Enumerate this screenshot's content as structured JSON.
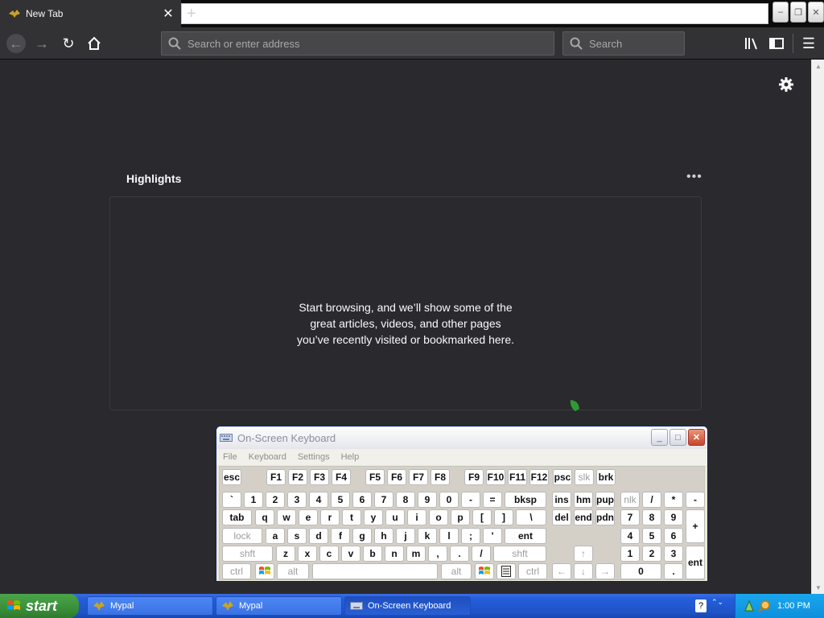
{
  "browser": {
    "tab_title": "New Tab",
    "tab_close": "✕",
    "newtab_plus": "+",
    "url_placeholder": "Search or enter address",
    "search_placeholder": "Search"
  },
  "page": {
    "highlights_title": "Highlights",
    "highlights_more": "•••",
    "highlights_message": "Start browsing, and we’ll show some of the great articles, videos, and other pages you’ve recently visited or bookmarked here."
  },
  "osk": {
    "title": "On-Screen Keyboard",
    "menu": [
      "File",
      "Keyboard",
      "Settings",
      "Help"
    ],
    "keys": [
      {
        "label": "esc"
      },
      {
        "label": "F1"
      },
      {
        "label": "F2"
      },
      {
        "label": "F3"
      },
      {
        "label": "F4"
      },
      {
        "label": "F5"
      },
      {
        "label": "F6"
      },
      {
        "label": "F7"
      },
      {
        "label": "F8"
      },
      {
        "label": "F9"
      },
      {
        "label": "F10"
      },
      {
        "label": "F11"
      },
      {
        "label": "F12"
      },
      {
        "label": "psc"
      },
      {
        "label": "slk",
        "dim": true
      },
      {
        "label": "brk"
      },
      {
        "label": "`"
      },
      {
        "label": "1"
      },
      {
        "label": "2"
      },
      {
        "label": "3"
      },
      {
        "label": "4"
      },
      {
        "label": "5"
      },
      {
        "label": "6"
      },
      {
        "label": "7"
      },
      {
        "label": "8"
      },
      {
        "label": "9"
      },
      {
        "label": "0"
      },
      {
        "label": "-"
      },
      {
        "label": "="
      },
      {
        "label": "bksp"
      },
      {
        "label": "ins"
      },
      {
        "label": "hm"
      },
      {
        "label": "pup"
      },
      {
        "label": "nlk",
        "dim": true
      },
      {
        "label": "/"
      },
      {
        "label": "*"
      },
      {
        "label": "-"
      },
      {
        "label": "tab"
      },
      {
        "label": "q"
      },
      {
        "label": "w"
      },
      {
        "label": "e"
      },
      {
        "label": "r"
      },
      {
        "label": "t"
      },
      {
        "label": "y"
      },
      {
        "label": "u"
      },
      {
        "label": "i"
      },
      {
        "label": "o"
      },
      {
        "label": "p"
      },
      {
        "label": "["
      },
      {
        "label": "]"
      },
      {
        "label": "\\"
      },
      {
        "label": "del"
      },
      {
        "label": "end"
      },
      {
        "label": "pdn"
      },
      {
        "label": "7"
      },
      {
        "label": "8"
      },
      {
        "label": "9"
      },
      {
        "label": "+"
      },
      {
        "label": "lock",
        "dim": true
      },
      {
        "label": "a"
      },
      {
        "label": "s"
      },
      {
        "label": "d"
      },
      {
        "label": "f"
      },
      {
        "label": "g"
      },
      {
        "label": "h"
      },
      {
        "label": "j"
      },
      {
        "label": "k"
      },
      {
        "label": "l"
      },
      {
        "label": ";"
      },
      {
        "label": "'"
      },
      {
        "label": "ent"
      },
      {
        "label": "4"
      },
      {
        "label": "5"
      },
      {
        "label": "6"
      },
      {
        "label": "shft",
        "dim": true
      },
      {
        "label": "z"
      },
      {
        "label": "x"
      },
      {
        "label": "c"
      },
      {
        "label": "v"
      },
      {
        "label": "b"
      },
      {
        "label": "n"
      },
      {
        "label": "m"
      },
      {
        "label": ","
      },
      {
        "label": "."
      },
      {
        "label": "/"
      },
      {
        "label": "shft",
        "dim": true
      },
      {
        "label": "↑",
        "dim": true
      },
      {
        "label": "1"
      },
      {
        "label": "2"
      },
      {
        "label": "3"
      },
      {
        "label": "ent"
      },
      {
        "label": "ctrl",
        "dim": true
      },
      {
        "label": "win",
        "icon": true
      },
      {
        "label": "alt",
        "dim": true
      },
      {
        "label": ""
      },
      {
        "label": "alt",
        "dim": true
      },
      {
        "label": "win",
        "icon": true
      },
      {
        "label": "menu",
        "icon": true
      },
      {
        "label": "ctrl",
        "dim": true
      },
      {
        "label": "←",
        "dim": true
      },
      {
        "label": "↓",
        "dim": true
      },
      {
        "label": "→",
        "dim": true
      },
      {
        "label": "0"
      },
      {
        "label": "."
      }
    ]
  },
  "taskbar": {
    "start_label": "start",
    "items": [
      "Mypal",
      "Mypal",
      "On-Screen Keyboard"
    ],
    "help_glyph": "?",
    "expand_glyph": "⌃⌄",
    "clock": "1:00 PM"
  }
}
